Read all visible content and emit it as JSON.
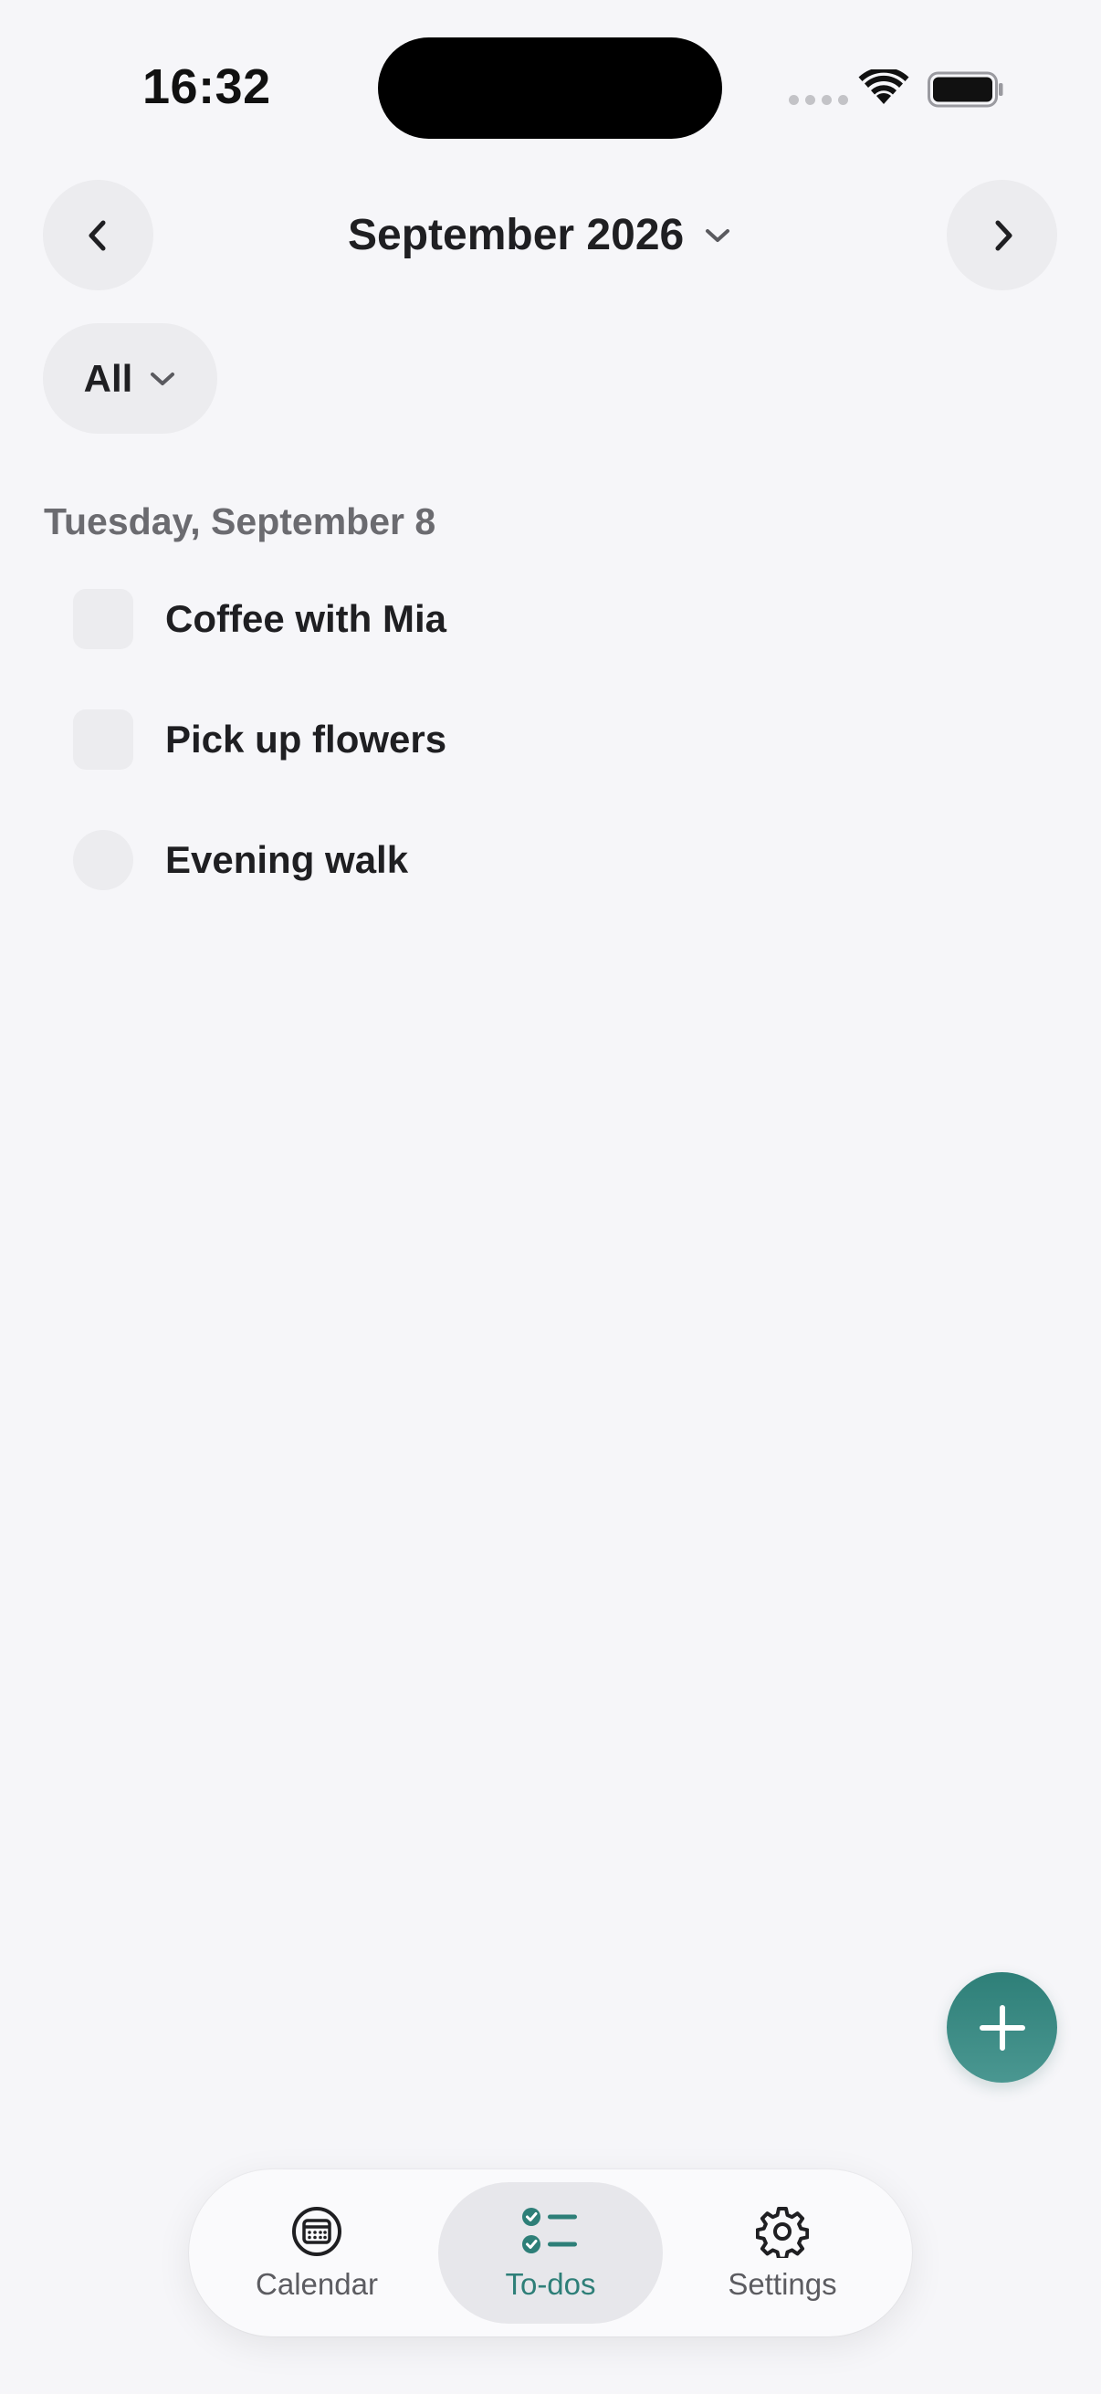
{
  "status_bar": {
    "time": "16:32"
  },
  "header": {
    "month_label": "September 2026"
  },
  "filter": {
    "label": "All"
  },
  "sections": [
    {
      "date": "Tuesday, September 8",
      "todos": [
        {
          "title": "Coffee with Mia",
          "checked": false,
          "shape": "square"
        },
        {
          "title": "Pick up flowers",
          "checked": false,
          "shape": "square"
        },
        {
          "title": "Evening walk",
          "checked": false,
          "shape": "circle"
        }
      ]
    }
  ],
  "fab": {
    "icon": "plus-icon"
  },
  "tab_bar": {
    "active": "todos",
    "tabs": [
      {
        "id": "calendar",
        "label": "Calendar",
        "icon": "calendar-icon"
      },
      {
        "id": "todos",
        "label": "To-dos",
        "icon": "checklist-icon"
      },
      {
        "id": "settings",
        "label": "Settings",
        "icon": "gear-icon"
      }
    ]
  },
  "colors": {
    "accent": "#2e7f78",
    "background": "#f6f6f9",
    "control_fill": "#ececef",
    "text_primary": "#1f1f22",
    "text_secondary": "#6b6b70"
  }
}
